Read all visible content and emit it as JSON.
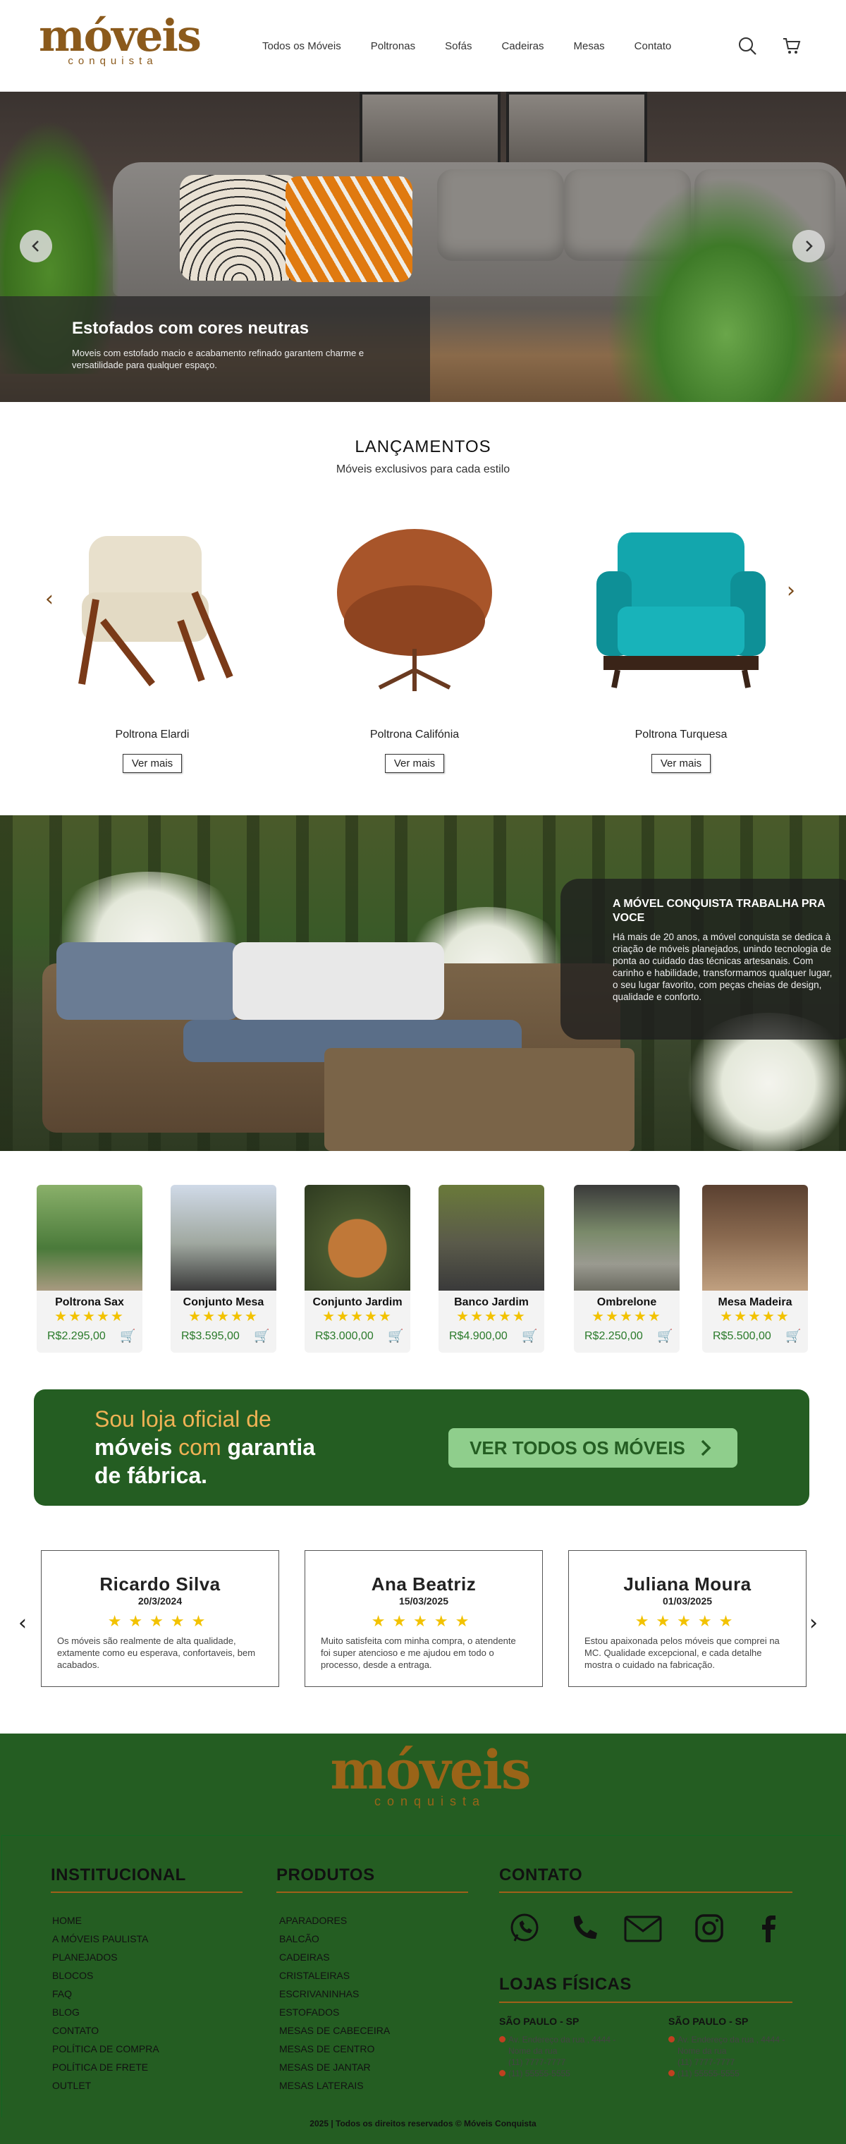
{
  "brand": {
    "word": "móveis",
    "sub": "conquista"
  },
  "nav": [
    "Todos os Móveis",
    "Poltronas",
    "Sofás",
    "Cadeiras",
    "Mesas",
    "Contato"
  ],
  "hero": {
    "title": "Estofados com cores neutras",
    "text": "Moveis com estofado macio e acabamento refinado garantem charme e versatilidade para qualquer espaço."
  },
  "launches": {
    "title": "LANÇAMENTOS",
    "subtitle": "Móveis exclusivos para cada estilo",
    "items": [
      {
        "name": "Poltrona Elardi",
        "button": "Ver mais"
      },
      {
        "name": "Poltrona Califónia",
        "button": "Ver mais"
      },
      {
        "name": "Poltrona Turquesa",
        "button": "Ver mais"
      }
    ]
  },
  "about": {
    "title": "A MÓVEL CONQUISTA TRABALHA PRA VOCE",
    "text": "Há mais de 20 anos, a móvel conquista se dedica à criação de móveis planejados, unindo tecnologia de ponta ao cuidado das técnicas artesanais. Com carinho e habilidade, transformamos qualquer lugar, o seu lugar favorito, com peças cheias de design, qualidade e conforto."
  },
  "cards": [
    {
      "name": "Poltrona Sax",
      "stars": "★★★★★",
      "price": "R$2.295,00"
    },
    {
      "name": "Conjunto Mesa",
      "stars": "★★★★★",
      "price": "R$3.595,00"
    },
    {
      "name": "Conjunto Jardim",
      "stars": "★★★★★",
      "price": "R$3.000,00"
    },
    {
      "name": "Banco Jardim",
      "stars": "★★★★★",
      "price": "R$4.900,00"
    },
    {
      "name": "Ombrelone",
      "stars": "★★★★★",
      "price": "R$2.250,00"
    },
    {
      "name": "Mesa Madeira",
      "stars": "★★★★★",
      "price": "R$5.500,00"
    }
  ],
  "banner": {
    "l1": "Sou loja oficial de",
    "l2a": "móveis",
    "l2b": "com",
    "l2c": "garantia",
    "l3": "de fábrica.",
    "button": "VER TODOS OS MÓVEIS"
  },
  "reviews": [
    {
      "name": "Ricardo Silva",
      "date": "20/3/2024",
      "stars": "★★★★★",
      "text": "Os móveis são realmente de alta qualidade, extamente como eu esperava, confortaveis, bem acabados."
    },
    {
      "name": "Ana Beatriz",
      "date": "15/03/2025",
      "stars": "★★★★★",
      "text": "Muito satisfeita com minha compra, o atendente foi super atencioso e me ajudou em todo o processo, desde a entraga."
    },
    {
      "name": "Juliana Moura",
      "date": "01/03/2025",
      "stars": "★★★★★",
      "text": "Estou apaixonada pelos móveis que comprei na MC. Qualidade excepcional, e cada detalhe mostra o cuidado na fabricação."
    }
  ],
  "footer": {
    "inst_title": "INSTITUCIONAL",
    "inst": [
      "HOME",
      "A MÓVEIS PAULISTA",
      "PLANEJADOS",
      "BLOCOS",
      "FAQ",
      "BLOG",
      "CONTATO",
      "POLÍTICA DE COMPRA",
      "POLÍTICA DE FRETE",
      "OUTLET"
    ],
    "prod_title": "PRODUTOS",
    "prod": [
      "APARADORES",
      "BALCÃO",
      "CADEIRAS",
      "CRISTALEIRAS",
      "ESCRIVANINHAS",
      "ESTOFADOS",
      "MESAS DE CABECEIRA",
      "MESAS DE CENTRO",
      "MESAS DE JANTAR",
      "MESAS LATERAIS"
    ],
    "contact_title": "CONTATO",
    "stores_title": "LOJAS FÍSICAS",
    "stores": [
      {
        "city": "SÃO PAULO - SP",
        "addr1": "Av. Endereço da rua , 4444 -",
        "addr2": "Nome da rua",
        "phone1": "(11) 7777-7777",
        "phone2": "(11) 55555-5555"
      },
      {
        "city": "SÃO PAULO - SP",
        "addr1": "Av. Endereço da rua , 4444 -",
        "addr2": "Nome da rua",
        "phone1": "(11) 7777-7777",
        "phone2": "(11) 55555-5555"
      }
    ],
    "copyright": "2025 | Todos os direitos reservados © Móveis Conquista"
  },
  "colors": {
    "brand": "#8b5a1c",
    "green": "#245d22",
    "star": "#f2c200",
    "price": "#2a7a2a"
  },
  "icons": [
    "search-icon",
    "cart-icon",
    "whatsapp-icon",
    "phone-icon",
    "mail-icon",
    "instagram-icon",
    "facebook-icon"
  ]
}
